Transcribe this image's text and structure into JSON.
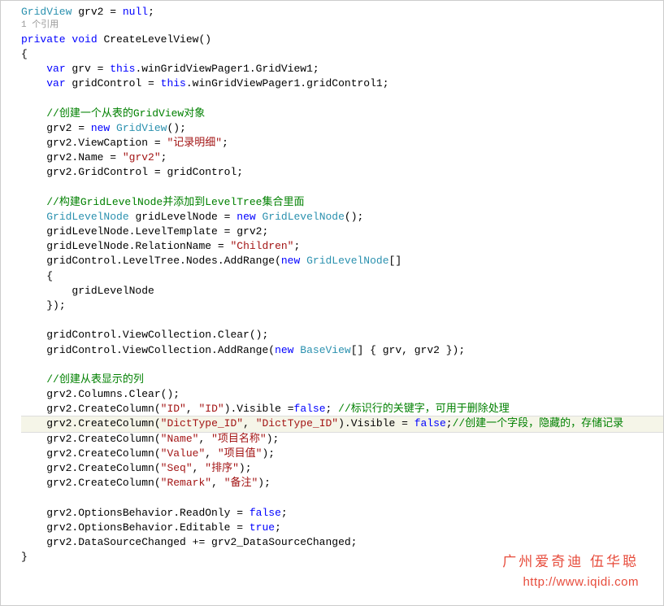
{
  "code_lines": [
    {
      "indent": 0,
      "segs": [
        {
          "t": "type",
          "v": "GridView"
        },
        {
          "t": "",
          "v": " grv2 = "
        },
        {
          "t": "kw",
          "v": "null"
        },
        {
          "t": "",
          "v": ";"
        }
      ]
    },
    {
      "indent": 0,
      "cls": "ref-note",
      "segs": [
        {
          "t": "",
          "v": "1 个引用"
        }
      ]
    },
    {
      "indent": 0,
      "segs": [
        {
          "t": "kw",
          "v": "private"
        },
        {
          "t": "",
          "v": " "
        },
        {
          "t": "kw",
          "v": "void"
        },
        {
          "t": "",
          "v": " CreateLevelView()"
        }
      ]
    },
    {
      "indent": 0,
      "segs": [
        {
          "t": "",
          "v": "{"
        }
      ]
    },
    {
      "indent": 1,
      "segs": [
        {
          "t": "kw",
          "v": "var"
        },
        {
          "t": "",
          "v": " grv = "
        },
        {
          "t": "kw",
          "v": "this"
        },
        {
          "t": "",
          "v": ".winGridViewPager1.GridView1;"
        }
      ]
    },
    {
      "indent": 1,
      "segs": [
        {
          "t": "kw",
          "v": "var"
        },
        {
          "t": "",
          "v": " gridControl = "
        },
        {
          "t": "kw",
          "v": "this"
        },
        {
          "t": "",
          "v": ".winGridViewPager1.gridControl1;"
        }
      ]
    },
    {
      "indent": 1,
      "segs": [
        {
          "t": "",
          "v": ""
        }
      ]
    },
    {
      "indent": 1,
      "segs": [
        {
          "t": "cmt",
          "v": "//创建一个从表的GridView对象"
        }
      ]
    },
    {
      "indent": 1,
      "segs": [
        {
          "t": "",
          "v": "grv2 = "
        },
        {
          "t": "kw",
          "v": "new"
        },
        {
          "t": "",
          "v": " "
        },
        {
          "t": "type",
          "v": "GridView"
        },
        {
          "t": "",
          "v": "();"
        }
      ]
    },
    {
      "indent": 1,
      "segs": [
        {
          "t": "",
          "v": "grv2.ViewCaption = "
        },
        {
          "t": "str",
          "v": "\"记录明细\""
        },
        {
          "t": "",
          "v": ";"
        }
      ]
    },
    {
      "indent": 1,
      "segs": [
        {
          "t": "",
          "v": "grv2.Name = "
        },
        {
          "t": "str",
          "v": "\"grv2\""
        },
        {
          "t": "",
          "v": ";"
        }
      ]
    },
    {
      "indent": 1,
      "segs": [
        {
          "t": "",
          "v": "grv2.GridControl = gridControl;"
        }
      ]
    },
    {
      "indent": 1,
      "segs": [
        {
          "t": "",
          "v": ""
        }
      ]
    },
    {
      "indent": 1,
      "segs": [
        {
          "t": "cmt",
          "v": "//构建GridLevelNode并添加到LevelTree集合里面"
        }
      ]
    },
    {
      "indent": 1,
      "segs": [
        {
          "t": "type",
          "v": "GridLevelNode"
        },
        {
          "t": "",
          "v": " gridLevelNode = "
        },
        {
          "t": "kw",
          "v": "new"
        },
        {
          "t": "",
          "v": " "
        },
        {
          "t": "type",
          "v": "GridLevelNode"
        },
        {
          "t": "",
          "v": "();"
        }
      ]
    },
    {
      "indent": 1,
      "segs": [
        {
          "t": "",
          "v": "gridLevelNode.LevelTemplate = grv2;"
        }
      ]
    },
    {
      "indent": 1,
      "segs": [
        {
          "t": "",
          "v": "gridLevelNode.RelationName = "
        },
        {
          "t": "str",
          "v": "\"Children\""
        },
        {
          "t": "",
          "v": ";"
        }
      ]
    },
    {
      "indent": 1,
      "segs": [
        {
          "t": "",
          "v": "gridControl.LevelTree.Nodes.AddRange("
        },
        {
          "t": "kw",
          "v": "new"
        },
        {
          "t": "",
          "v": " "
        },
        {
          "t": "type",
          "v": "GridLevelNode"
        },
        {
          "t": "",
          "v": "[]"
        }
      ]
    },
    {
      "indent": 1,
      "segs": [
        {
          "t": "",
          "v": "{"
        }
      ]
    },
    {
      "indent": 2,
      "segs": [
        {
          "t": "",
          "v": "gridLevelNode"
        }
      ]
    },
    {
      "indent": 1,
      "segs": [
        {
          "t": "",
          "v": "});"
        }
      ]
    },
    {
      "indent": 1,
      "segs": [
        {
          "t": "",
          "v": ""
        }
      ]
    },
    {
      "indent": 1,
      "segs": [
        {
          "t": "",
          "v": "gridControl.ViewCollection.Clear();"
        }
      ]
    },
    {
      "indent": 1,
      "segs": [
        {
          "t": "",
          "v": "gridControl.ViewCollection.AddRange("
        },
        {
          "t": "kw",
          "v": "new"
        },
        {
          "t": "",
          "v": " "
        },
        {
          "t": "type",
          "v": "BaseView"
        },
        {
          "t": "",
          "v": "[] { grv, grv2 });"
        }
      ]
    },
    {
      "indent": 1,
      "segs": [
        {
          "t": "",
          "v": ""
        }
      ]
    },
    {
      "indent": 1,
      "segs": [
        {
          "t": "cmt",
          "v": "//创建从表显示的列"
        }
      ]
    },
    {
      "indent": 1,
      "segs": [
        {
          "t": "",
          "v": "grv2.Columns.Clear();"
        }
      ]
    },
    {
      "indent": 1,
      "segs": [
        {
          "t": "",
          "v": "grv2.CreateColumn("
        },
        {
          "t": "str",
          "v": "\"ID\""
        },
        {
          "t": "",
          "v": ", "
        },
        {
          "t": "str",
          "v": "\"ID\""
        },
        {
          "t": "",
          "v": ").Visible ="
        },
        {
          "t": "kw",
          "v": "false"
        },
        {
          "t": "",
          "v": "; "
        },
        {
          "t": "cmt",
          "v": "//标识行的关键字，可用于删除处理"
        }
      ]
    },
    {
      "indent": 1,
      "hl": true,
      "segs": [
        {
          "t": "",
          "v": "grv2.CreateColumn("
        },
        {
          "t": "str",
          "v": "\"DictType_ID\""
        },
        {
          "t": "",
          "v": ", "
        },
        {
          "t": "str",
          "v": "\"DictType_ID\""
        },
        {
          "t": "",
          "v": ").Visible = "
        },
        {
          "t": "kw",
          "v": "false"
        },
        {
          "t": "",
          "v": ";"
        },
        {
          "t": "cmt",
          "v": "//创建一个字段，隐藏的，存储记录"
        }
      ]
    },
    {
      "indent": 1,
      "segs": [
        {
          "t": "",
          "v": "grv2.CreateColumn("
        },
        {
          "t": "str",
          "v": "\"Name\""
        },
        {
          "t": "",
          "v": ", "
        },
        {
          "t": "str",
          "v": "\"项目名称\""
        },
        {
          "t": "",
          "v": ");"
        }
      ]
    },
    {
      "indent": 1,
      "segs": [
        {
          "t": "",
          "v": "grv2.CreateColumn("
        },
        {
          "t": "str",
          "v": "\"Value\""
        },
        {
          "t": "",
          "v": ", "
        },
        {
          "t": "str",
          "v": "\"项目值\""
        },
        {
          "t": "",
          "v": ");"
        }
      ]
    },
    {
      "indent": 1,
      "segs": [
        {
          "t": "",
          "v": "grv2.CreateColumn("
        },
        {
          "t": "str",
          "v": "\"Seq\""
        },
        {
          "t": "",
          "v": ", "
        },
        {
          "t": "str",
          "v": "\"排序\""
        },
        {
          "t": "",
          "v": ");"
        }
      ]
    },
    {
      "indent": 1,
      "segs": [
        {
          "t": "",
          "v": "grv2.CreateColumn("
        },
        {
          "t": "str",
          "v": "\"Remark\""
        },
        {
          "t": "",
          "v": ", "
        },
        {
          "t": "str",
          "v": "\"备注\""
        },
        {
          "t": "",
          "v": ");"
        }
      ]
    },
    {
      "indent": 1,
      "segs": [
        {
          "t": "",
          "v": ""
        }
      ]
    },
    {
      "indent": 1,
      "segs": [
        {
          "t": "",
          "v": "grv2.OptionsBehavior.ReadOnly = "
        },
        {
          "t": "kw",
          "v": "false"
        },
        {
          "t": "",
          "v": ";"
        }
      ]
    },
    {
      "indent": 1,
      "segs": [
        {
          "t": "",
          "v": "grv2.OptionsBehavior.Editable = "
        },
        {
          "t": "kw",
          "v": "true"
        },
        {
          "t": "",
          "v": ";"
        }
      ]
    },
    {
      "indent": 1,
      "segs": [
        {
          "t": "",
          "v": "grv2.DataSourceChanged += grv2_DataSourceChanged;"
        }
      ]
    },
    {
      "indent": 0,
      "segs": [
        {
          "t": "",
          "v": "}"
        }
      ]
    }
  ],
  "watermark": {
    "line1": "广州爱奇迪 伍华聪",
    "line2": "http://www.iqidi.com"
  }
}
